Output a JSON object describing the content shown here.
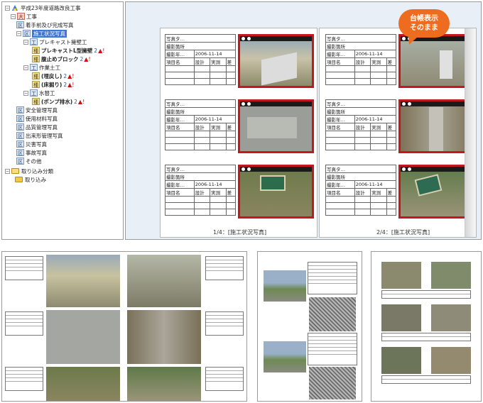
{
  "tree": {
    "root": "平成23年度道路改良工事",
    "work": {
      "tag": "大",
      "label": "工事"
    },
    "items": [
      {
        "tag": "区",
        "label": "着手前及び完成写真"
      },
      {
        "tag": "区",
        "label": "施工状況写真",
        "selected": true
      },
      {
        "tag": "工",
        "label": "プレキャスト擁壁工"
      },
      {
        "tag": "種",
        "label": "プレキャストL型擁壁",
        "count": "2"
      },
      {
        "tag": "種",
        "label": "腹止めブロック",
        "count": "2"
      },
      {
        "tag": "工",
        "label": "作業土工"
      },
      {
        "tag": "種",
        "label": "(埋戻し)",
        "count": "2"
      },
      {
        "tag": "種",
        "label": "(床掘り)",
        "count": "2"
      },
      {
        "tag": "工",
        "label": "水替工"
      },
      {
        "tag": "種",
        "label": "(ポンプ排水)",
        "count": "2"
      },
      {
        "tag": "区",
        "label": "安全管理写真"
      },
      {
        "tag": "区",
        "label": "使用材料写真"
      },
      {
        "tag": "区",
        "label": "品質管理写真"
      },
      {
        "tag": "区",
        "label": "出来形管理写真"
      },
      {
        "tag": "区",
        "label": "災害写真"
      },
      {
        "tag": "区",
        "label": "事故写真"
      },
      {
        "tag": "区",
        "label": "その他"
      }
    ],
    "import_group": "取り込み分類",
    "import_child": "取り込み",
    "warn_symbol": "▲!"
  },
  "viewer": {
    "callout_line1": "台帳表示",
    "callout_line2": "そのまま",
    "form": {
      "r1": "写真タ…",
      "r2": "撮影箇所",
      "r3_label": "撮影年…",
      "r3_value": "2006-11-14",
      "h1": "項目名",
      "h2": "設計",
      "h3": "実測",
      "h4": "差"
    },
    "page_left": "1/4：[施工状況写真]",
    "page_right": "2/4：[施工状況写真]"
  },
  "colors": {
    "accent": "#ee6c1f",
    "photo_border": "#c2181e",
    "selection": "#3a78d8"
  }
}
